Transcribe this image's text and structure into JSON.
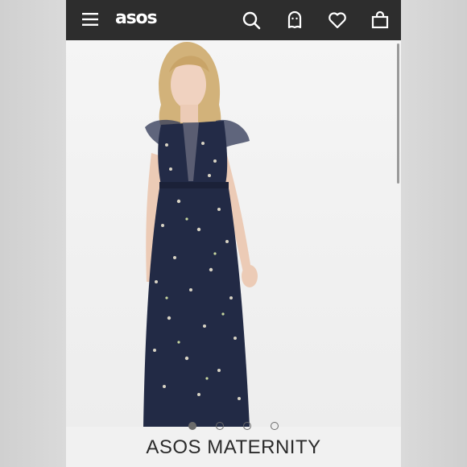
{
  "app": {
    "logo_text": "asos",
    "icons": [
      "menu-icon",
      "search-icon",
      "account-icon",
      "heart-icon",
      "bag-icon"
    ]
  },
  "product": {
    "brand": "ASOS MATERNITY",
    "image_description_colors": {
      "dress": "#222a45",
      "background": "#f1f1f1"
    },
    "carousel": {
      "total": 4,
      "active_index": 0
    }
  },
  "colors": {
    "header_bg": "#2d2d2d",
    "header_icon": "#ffffff"
  }
}
